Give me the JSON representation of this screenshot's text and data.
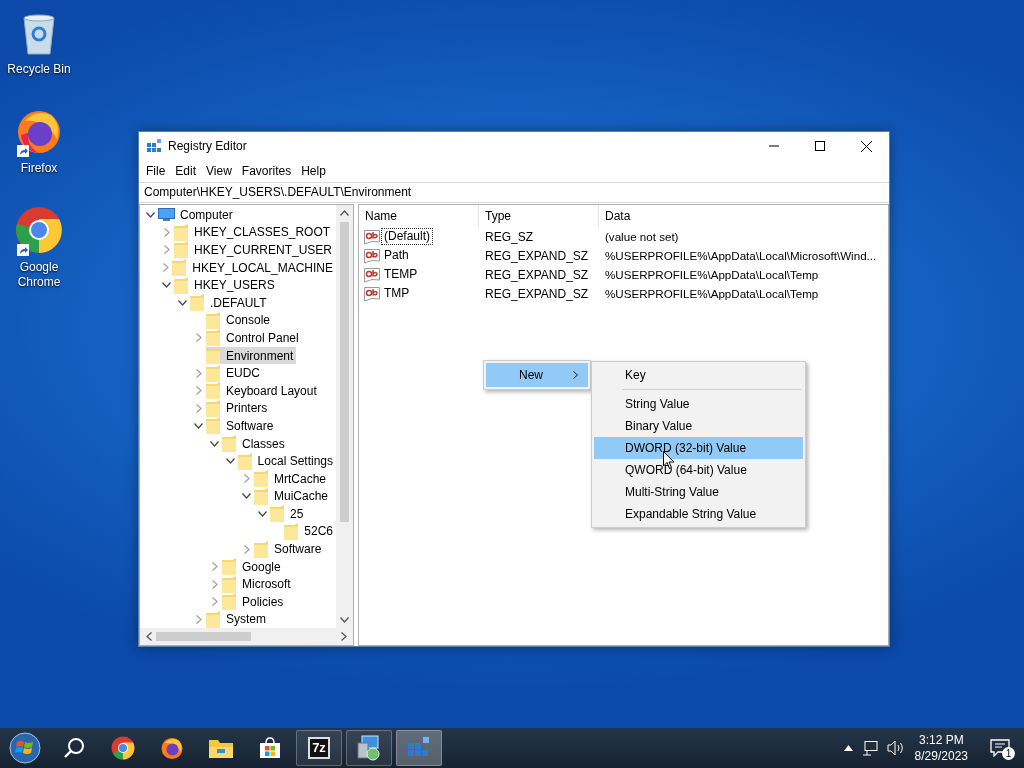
{
  "desktop_icons": [
    {
      "label": "Recycle Bin",
      "kind": "recycle-bin",
      "shortcut": false
    },
    {
      "label": "Firefox",
      "kind": "firefox",
      "shortcut": true
    },
    {
      "label": "Google Chrome",
      "kind": "chrome",
      "shortcut": true
    }
  ],
  "window": {
    "title": "Registry Editor",
    "menu": [
      "File",
      "Edit",
      "View",
      "Favorites",
      "Help"
    ],
    "address": "Computer\\HKEY_USERS\\.DEFAULT\\Environment"
  },
  "tree": [
    {
      "label": "Computer",
      "kind": "computer",
      "expanded": true,
      "selected": false,
      "children": [
        {
          "label": "HKEY_CLASSES_ROOT",
          "expanded": false,
          "selected": false
        },
        {
          "label": "HKEY_CURRENT_USER",
          "expanded": false,
          "selected": false
        },
        {
          "label": "HKEY_LOCAL_MACHINE",
          "expanded": false,
          "selected": false
        },
        {
          "label": "HKEY_USERS",
          "expanded": true,
          "selected": false,
          "children": [
            {
              "label": ".DEFAULT",
              "expanded": true,
              "selected": false,
              "children": [
                {
                  "label": "Console",
                  "selected": false
                },
                {
                  "label": "Control Panel",
                  "expanded": false,
                  "selected": false
                },
                {
                  "label": "Environment",
                  "selected": true
                },
                {
                  "label": "EUDC",
                  "expanded": false,
                  "selected": false
                },
                {
                  "label": "Keyboard Layout",
                  "expanded": false,
                  "selected": false
                },
                {
                  "label": "Printers",
                  "expanded": false,
                  "selected": false
                },
                {
                  "label": "Software",
                  "expanded": true,
                  "selected": false,
                  "children": [
                    {
                      "label": "Classes",
                      "expanded": true,
                      "selected": false,
                      "children": [
                        {
                          "label": "Local Settings",
                          "expanded": true,
                          "selected": false,
                          "children": [
                            {
                              "label": "MrtCache",
                              "expanded": false,
                              "selected": false
                            },
                            {
                              "label": "MuiCache",
                              "expanded": true,
                              "selected": false,
                              "children": [
                                {
                                  "label": "25",
                                  "expanded": true,
                                  "selected": false,
                                  "children": [
                                    {
                                      "label": "52C6",
                                      "selected": false
                                    }
                                  ]
                                }
                              ]
                            },
                            {
                              "label": "Software",
                              "expanded": false,
                              "selected": false
                            }
                          ]
                        }
                      ]
                    },
                    {
                      "label": "Google",
                      "expanded": false,
                      "selected": false
                    },
                    {
                      "label": "Microsoft",
                      "expanded": false,
                      "selected": false
                    },
                    {
                      "label": "Policies",
                      "expanded": false,
                      "selected": false
                    }
                  ]
                },
                {
                  "label": "System",
                  "expanded": false,
                  "selected": false
                }
              ]
            }
          ]
        }
      ]
    }
  ],
  "values": {
    "columns": [
      "Name",
      "Type",
      "Data"
    ],
    "rows": [
      {
        "name": "(Default)",
        "type": "REG_SZ",
        "data": "(value not set)",
        "focused": true
      },
      {
        "name": "Path",
        "type": "REG_EXPAND_SZ",
        "data": "%USERPROFILE%\\AppData\\Local\\Microsoft\\Wind...",
        "focused": false
      },
      {
        "name": "TEMP",
        "type": "REG_EXPAND_SZ",
        "data": "%USERPROFILE%\\AppData\\Local\\Temp",
        "focused": false
      },
      {
        "name": "TMP",
        "type": "REG_EXPAND_SZ",
        "data": "%USERPROFILE%\\AppData\\Local\\Temp",
        "focused": false
      }
    ]
  },
  "context_menu": {
    "items": [
      {
        "label": "New",
        "selected": true
      }
    ],
    "submenu": [
      {
        "kind": "item",
        "label": "Key",
        "selected": false
      },
      {
        "kind": "separator"
      },
      {
        "kind": "item",
        "label": "String Value",
        "selected": false
      },
      {
        "kind": "item",
        "label": "Binary Value",
        "selected": false
      },
      {
        "kind": "item",
        "label": "DWORD (32-bit) Value",
        "selected": true
      },
      {
        "kind": "item",
        "label": "QWORD (64-bit) Value",
        "selected": false
      },
      {
        "kind": "item",
        "label": "Multi-String Value",
        "selected": false
      },
      {
        "kind": "item",
        "label": "Expandable String Value",
        "selected": false
      }
    ]
  },
  "taskbar": {
    "apps": [
      {
        "kind": "start",
        "running": false,
        "selected": false
      },
      {
        "kind": "search",
        "running": false,
        "selected": false
      },
      {
        "kind": "chrome",
        "running": false,
        "selected": false
      },
      {
        "kind": "firefox",
        "running": false,
        "selected": false
      },
      {
        "kind": "explorer",
        "running": false,
        "selected": false
      },
      {
        "kind": "store",
        "running": false,
        "selected": false
      },
      {
        "kind": "archiver",
        "label": "7z",
        "running": true,
        "selected": false
      },
      {
        "kind": "setup",
        "running": true,
        "selected": false
      },
      {
        "kind": "regedit",
        "running": true,
        "selected": true
      }
    ],
    "clock": {
      "time": "3:12 PM",
      "date": "8/29/2023"
    },
    "notification_count": "1"
  }
}
